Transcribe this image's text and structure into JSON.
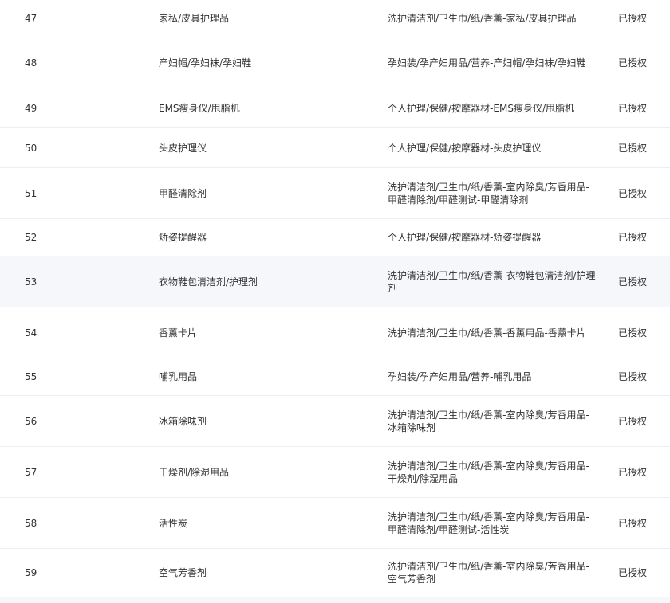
{
  "table": {
    "rows": [
      {
        "no": "47",
        "name": "家私/皮具护理品",
        "category": "洗护清洁剂/卫生巾/纸/香薰-家私/皮具护理品",
        "status": "已授权"
      },
      {
        "no": "48",
        "name": "产妇帽/孕妇袜/孕妇鞋",
        "category": "孕妇装/孕产妇用品/营养-产妇帽/孕妇袜/孕妇鞋",
        "status": "已授权"
      },
      {
        "no": "49",
        "name": "EMS瘦身仪/甩脂机",
        "category": "个人护理/保健/按摩器材-EMS瘦身仪/甩脂机",
        "status": "已授权"
      },
      {
        "no": "50",
        "name": "头皮护理仪",
        "category": "个人护理/保健/按摩器材-头皮护理仪",
        "status": "已授权"
      },
      {
        "no": "51",
        "name": "甲醛清除剂",
        "category": "洗护清洁剂/卫生巾/纸/香薰-室内除臭/芳香用品-甲醛清除剂/甲醛测试-甲醛清除剂",
        "status": "已授权"
      },
      {
        "no": "52",
        "name": "矫姿提醒器",
        "category": "个人护理/保健/按摩器材-矫姿提醒器",
        "status": "已授权"
      },
      {
        "no": "53",
        "name": "衣物鞋包清洁剂/护理剂",
        "category": "洗护清洁剂/卫生巾/纸/香薰-衣物鞋包清洁剂/护理剂",
        "status": "已授权"
      },
      {
        "no": "54",
        "name": "香薰卡片",
        "category": "洗护清洁剂/卫生巾/纸/香薰-香薰用品-香薰卡片",
        "status": "已授权"
      },
      {
        "no": "55",
        "name": "哺乳用品",
        "category": "孕妇装/孕产妇用品/营养-哺乳用品",
        "status": "已授权"
      },
      {
        "no": "56",
        "name": "冰箱除味剂",
        "category": "洗护清洁剂/卫生巾/纸/香薰-室内除臭/芳香用品-冰箱除味剂",
        "status": "已授权"
      },
      {
        "no": "57",
        "name": "干燥剂/除湿用品",
        "category": "洗护清洁剂/卫生巾/纸/香薰-室内除臭/芳香用品-干燥剂/除湿用品",
        "status": "已授权"
      },
      {
        "no": "58",
        "name": "活性炭",
        "category": "洗护清洁剂/卫生巾/纸/香薰-室内除臭/芳香用品-甲醛清除剂/甲醛测试-活性炭",
        "status": "已授权"
      },
      {
        "no": "59",
        "name": "空气芳香剂",
        "category": "洗护清洁剂/卫生巾/纸/香薰-室内除臭/芳香用品-空气芳香剂",
        "status": "已授权"
      }
    ]
  }
}
